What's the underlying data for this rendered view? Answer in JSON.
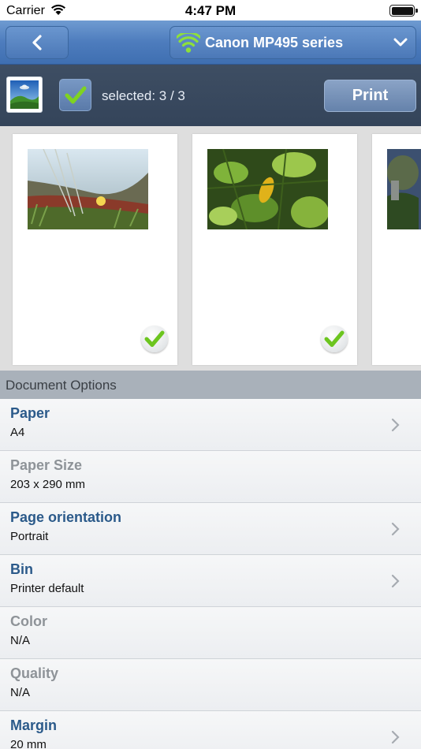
{
  "status_bar": {
    "carrier": "Carrier",
    "time": "4:47 PM"
  },
  "nav": {
    "printer_name": "Canon MP495 series"
  },
  "toolbar": {
    "selected_text": "selected: 3 / 3",
    "print_label": "Print"
  },
  "section": {
    "title": "Document Options"
  },
  "options": [
    {
      "title": "Paper",
      "value": "A4",
      "enabled": true,
      "has_chevron": true
    },
    {
      "title": "Paper Size",
      "value": "203 x 290 mm",
      "enabled": false,
      "has_chevron": false
    },
    {
      "title": "Page orientation",
      "value": "Portrait",
      "enabled": true,
      "has_chevron": true
    },
    {
      "title": "Bin",
      "value": "Printer default",
      "enabled": true,
      "has_chevron": true
    },
    {
      "title": "Color",
      "value": "N/A",
      "enabled": false,
      "has_chevron": false
    },
    {
      "title": "Quality",
      "value": "N/A",
      "enabled": false,
      "has_chevron": false
    },
    {
      "title": "Margin",
      "value": "20 mm",
      "enabled": true,
      "has_chevron": true
    }
  ],
  "colors": {
    "nav_blue": "#4d7cbd",
    "toolbar_dark": "#3e4e63",
    "title_blue": "#2b5a8a",
    "check_green": "#6cc51f"
  }
}
